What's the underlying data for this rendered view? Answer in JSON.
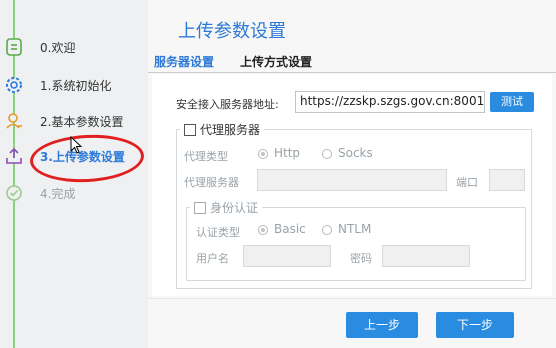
{
  "wizard": {
    "steps": [
      {
        "label": "0.欢迎",
        "icon": "welcome-icon",
        "state": "done"
      },
      {
        "label": "1.系统初始化",
        "icon": "gear-icon",
        "state": "done"
      },
      {
        "label": "2.基本参数设置",
        "icon": "user-icon",
        "state": "done"
      },
      {
        "label": "3.上传参数设置",
        "icon": "upload-tray-icon",
        "state": "active"
      },
      {
        "label": "4.完成",
        "icon": "check-circle-icon",
        "state": "disabled"
      }
    ]
  },
  "page": {
    "title": "上传参数设置"
  },
  "tabs": [
    "服务器设置",
    "上传方式设置"
  ],
  "server": {
    "address_label": "安全接入服务器地址:",
    "address_value": "https://zzskp.szgs.gov.cn:8001",
    "test_button": "测试"
  },
  "proxy": {
    "enable_label": "代理服务器",
    "enabled": false,
    "type_label": "代理类型",
    "type_options": [
      "Http",
      "Socks"
    ],
    "type_selected": "Http",
    "server_label": "代理服务器",
    "port_label": "端口",
    "auth": {
      "enable_label": "身份认证",
      "enabled": false,
      "type_label": "认证类型",
      "type_options": [
        "Basic",
        "NTLM"
      ],
      "type_selected": "Basic",
      "username_label": "用户名",
      "password_label": "密码"
    }
  },
  "nav": {
    "prev": "上一步",
    "next": "下一步"
  },
  "colors": {
    "accent": "#2f7ad8",
    "button": "#2a8ce0",
    "progress_line": "#8ccf7d",
    "annotation": "#e02020"
  }
}
